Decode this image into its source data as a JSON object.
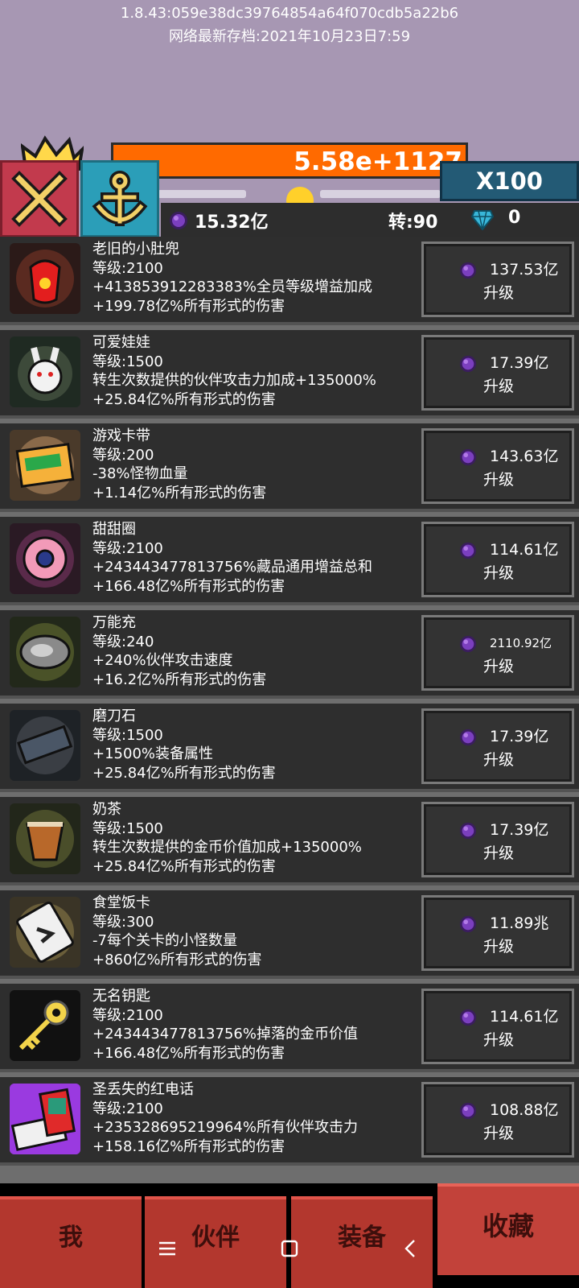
{
  "header": {
    "version_line": "1.8.43:059e38dc39764854a64f070cdb5a22b6",
    "save_line": "网络最新存档:2021年10月23日7:59"
  },
  "boss": {
    "hp": "5.58e+1127"
  },
  "multiplier": {
    "label": "X100"
  },
  "resources": {
    "orbs": "15.32亿",
    "turns": "转:90",
    "gems": "0"
  },
  "items": [
    {
      "name": "老旧的小肚兜",
      "level": "等级:2100",
      "effect": "+413853912283383%全员等级增益加成",
      "damage": "+199.78亿%所有形式的伤害",
      "cost": "137.53亿",
      "action": "升级",
      "icon": "apron-icon"
    },
    {
      "name": "可爱娃娃",
      "level": "等级:1500",
      "effect": "转生次数提供的伙伴攻击力加成+135000%",
      "damage": "+25.84亿%所有形式的伤害",
      "cost": "17.39亿",
      "action": "升级",
      "icon": "bunny-doll-icon"
    },
    {
      "name": "游戏卡带",
      "level": "等级:200",
      "effect": "-38%怪物血量",
      "damage": "+1.14亿%所有形式的伤害",
      "cost": "143.63亿",
      "action": "升级",
      "icon": "game-cartridge-icon"
    },
    {
      "name": "甜甜圈",
      "level": "等级:2100",
      "effect": "+243443477813756%藏品通用增益总和",
      "damage": "+166.48亿%所有形式的伤害",
      "cost": "114.61亿",
      "action": "升级",
      "icon": "donut-icon"
    },
    {
      "name": "万能充",
      "level": "等级:240",
      "effect": "+240%伙伴攻击速度",
      "damage": "+16.2亿%所有形式的伤害",
      "cost": "2110.92亿",
      "action": "升级",
      "icon": "charger-icon"
    },
    {
      "name": "磨刀石",
      "level": "等级:1500",
      "effect": "+1500%装备属性",
      "damage": "+25.84亿%所有形式的伤害",
      "cost": "17.39亿",
      "action": "升级",
      "icon": "whetstone-icon"
    },
    {
      "name": "奶茶",
      "level": "等级:1500",
      "effect": "转生次数提供的金币价值加成+135000%",
      "damage": "+25.84亿%所有形式的伤害",
      "cost": "17.39亿",
      "action": "升级",
      "icon": "milk-tea-icon"
    },
    {
      "name": "食堂饭卡",
      "level": "等级:300",
      "effect": "-7每个关卡的小怪数量",
      "damage": "+860亿%所有形式的伤害",
      "cost": "11.89兆",
      "action": "升级",
      "icon": "meal-card-icon"
    },
    {
      "name": "无名钥匙",
      "level": "等级:2100",
      "effect": "+243443477813756%掉落的金币价值",
      "damage": "+166.48亿%所有形式的伤害",
      "cost": "114.61亿",
      "action": "升级",
      "icon": "key-icon"
    },
    {
      "name": "圣丢失的红电话",
      "level": "等级:2100",
      "effect": "+235328695219964%所有伙伴攻击力",
      "damage": "+158.16亿%所有形式的伤害",
      "cost": "108.88亿",
      "action": "升级",
      "icon": "red-phone-icon"
    }
  ],
  "tabs": {
    "me": "我",
    "partner": "伙伴",
    "equip": "装备",
    "collection": "收藏"
  },
  "colors": {
    "top_bg": "#a797b3",
    "hp_bar": "#ff6a00",
    "tab_red": "#b3372e",
    "orb_purple": "#7b3fbf"
  }
}
